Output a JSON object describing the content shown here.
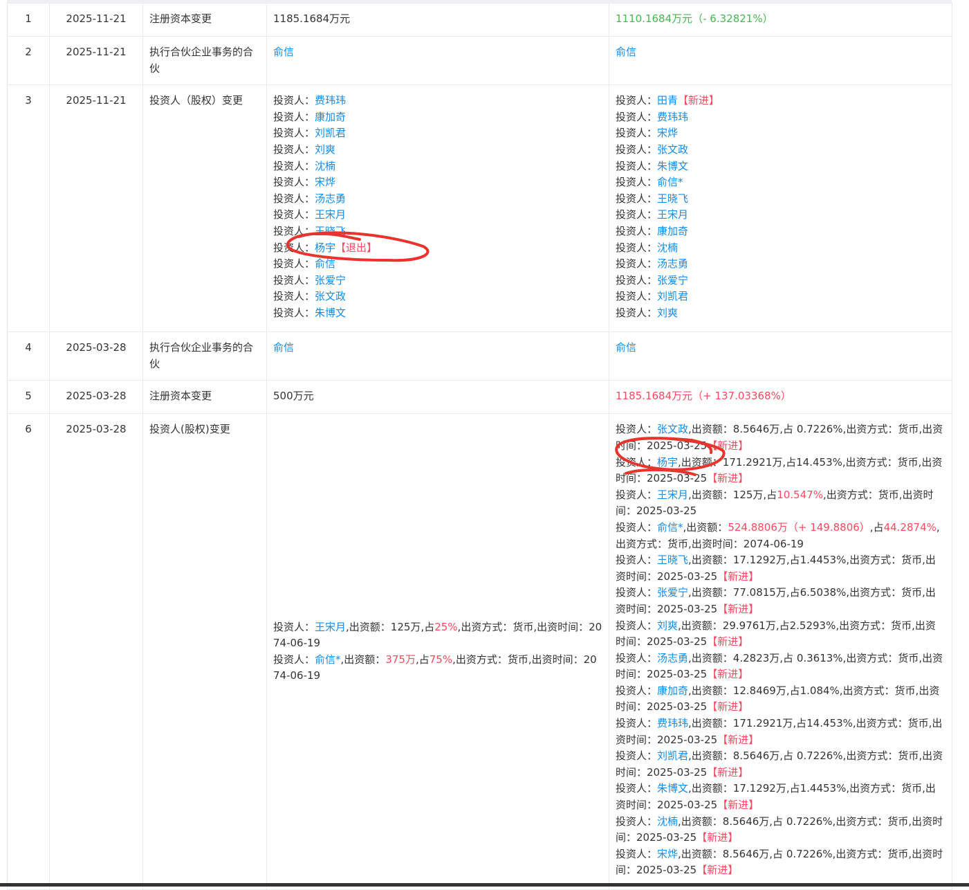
{
  "rows": [
    {
      "no": "1",
      "date": "2025-11-21",
      "item": "注册资本变更",
      "before_text": "1185.1684万元",
      "after_text": "1110.1684万元（- 6.32821%）"
    },
    {
      "no": "2",
      "date": "2025-11-21",
      "item": "执行合伙企业事务的合伙",
      "before_link": "俞信",
      "after_link": "俞信"
    },
    {
      "no": "3",
      "date": "2025-11-21",
      "item": "投资人（股权）变更",
      "before": [
        {
          "label": "投资人：",
          "name": "费玮玮"
        },
        {
          "label": "投资人：",
          "name": "康加奇"
        },
        {
          "label": "投资人：",
          "name": "刘凯君"
        },
        {
          "label": "投资人：",
          "name": "刘爽"
        },
        {
          "label": "投资人：",
          "name": "沈楠"
        },
        {
          "label": "投资人：",
          "name": "宋烨"
        },
        {
          "label": "投资人：",
          "name": "汤志勇"
        },
        {
          "label": "投资人：",
          "name": "王宋月"
        },
        {
          "label": "投资人：",
          "name": "王晓飞"
        },
        {
          "label": "投资人：",
          "name": "杨宇",
          "tag": "【退出】"
        },
        {
          "label": "投资人：",
          "name": "俞信"
        },
        {
          "label": "投资人：",
          "name": "张爱宁"
        },
        {
          "label": "投资人：",
          "name": "张文政"
        },
        {
          "label": "投资人：",
          "name": "朱博文"
        }
      ],
      "after": [
        {
          "label": "投资人：",
          "name": "田青",
          "tag": "【新进】"
        },
        {
          "label": "投资人：",
          "name": "费玮玮"
        },
        {
          "label": "投资人：",
          "name": "宋烨"
        },
        {
          "label": "投资人：",
          "name": "张文政"
        },
        {
          "label": "投资人：",
          "name": "朱博文"
        },
        {
          "label": "投资人：",
          "name": "俞信*"
        },
        {
          "label": "投资人：",
          "name": "王晓飞"
        },
        {
          "label": "投资人：",
          "name": "王宋月"
        },
        {
          "label": "投资人：",
          "name": "康加奇"
        },
        {
          "label": "投资人：",
          "name": "沈楠"
        },
        {
          "label": "投资人：",
          "name": "汤志勇"
        },
        {
          "label": "投资人：",
          "name": "张爱宁"
        },
        {
          "label": "投资人：",
          "name": "刘凯君"
        },
        {
          "label": "投资人：",
          "name": "刘爽"
        }
      ]
    },
    {
      "no": "4",
      "date": "2025-03-28",
      "item": "执行合伙企业事务的合伙",
      "before_link": "俞信",
      "after_link": "俞信"
    },
    {
      "no": "5",
      "date": "2025-03-28",
      "item": "注册资本变更",
      "before_text": "500万元",
      "after_text": "1185.1684万元（+ 137.03368%）"
    },
    {
      "no": "6",
      "date": "2025-03-28",
      "item": "投资人(股权)变更",
      "before": [
        {
          "label": "投资人：",
          "name": "王宋月",
          "t1": ",出资额：125万,占",
          "r1": "25%",
          "t2": ",出资方式：货币,出资时间：2074-06-19"
        },
        {
          "label": "投资人：",
          "name": "俞信*",
          "t1": ",出资额：",
          "r1": "375万",
          "t2": ",占",
          "r2": "75%",
          "t3": ",出资方式：货币,出资时间：2074-06-19"
        }
      ],
      "after": [
        {
          "label": "投资人：",
          "name": "张文政",
          "t1": ",出资额：8.5646万,占 0.7226%,出资方式：货币,出资时间：2025-03-25",
          "tag": "【新进】"
        },
        {
          "label": "投资人：",
          "name": "杨宇",
          "t1": ",出资额：171.2921万,占14.453%,出资方式：货币,出资时间：2025-03-25",
          "tag": "【新进】"
        },
        {
          "label": "投资人：",
          "name": "王宋月",
          "t1": ",出资额：125万,占",
          "r1": "10.547%",
          "t2": ",出资方式：货币,出资时间：2025-03-25"
        },
        {
          "label": "投资人：",
          "name": "俞信*",
          "t1": ",出资额：",
          "r1": "524.8806万（+ 149.8806）",
          "t2": ",占",
          "r2": "44.2874%",
          "t3": ",出资方式：货币,出资时间：2074-06-19"
        },
        {
          "label": "投资人：",
          "name": "王晓飞",
          "t1": ",出资额：17.1292万,占1.4453%,出资方式：货币,出资时间：2025-03-25",
          "tag": "【新进】"
        },
        {
          "label": "投资人：",
          "name": "张爱宁",
          "t1": ",出资额：77.0815万,占6.5038%,出资方式：货币,出资时间：2025-03-25",
          "tag": "【新进】"
        },
        {
          "label": "投资人：",
          "name": "刘爽",
          "t1": ",出资额：29.9761万,占2.5293%,出资方式：货币,出资时间：2025-03-25",
          "tag": "【新进】"
        },
        {
          "label": "投资人：",
          "name": "汤志勇",
          "t1": ",出资额：4.2823万,占 0.3613%,出资方式：货币,出资时间：2025-03-25",
          "tag": "【新进】"
        },
        {
          "label": "投资人：",
          "name": "康加奇",
          "t1": ",出资额：12.8469万,占1.084%,出资方式：货币,出资时间：2025-03-25",
          "tag": "【新进】"
        },
        {
          "label": "投资人：",
          "name": "费玮玮",
          "t1": ",出资额：171.2921万,占14.453%,出资方式：货币,出资时间：2025-03-25",
          "tag": "【新进】"
        },
        {
          "label": "投资人：",
          "name": "刘凯君",
          "t1": ",出资额：8.5646万,占 0.7226%,出资方式：货币,出资时间：2025-03-25",
          "tag": "【新进】"
        },
        {
          "label": "投资人：",
          "name": "朱博文",
          "t1": ",出资额：17.1292万,占1.4453%,出资方式：货币,出资时间：2025-03-25",
          "tag": "【新进】"
        },
        {
          "label": "投资人：",
          "name": "沈楠",
          "t1": ",出资额：8.5646万,占 0.7226%,出资方式：货币,出资时间：2025-03-25",
          "tag": "【新进】"
        },
        {
          "label": "投资人：",
          "name": "宋烨",
          "t1": ",出资额：8.5646万,占 0.7226%,出资方式：货币,出资时间：2025-03-25",
          "tag": "【新进】"
        }
      ]
    }
  ],
  "colors": {
    "link": "#128bed",
    "highlight_red": "#fd485e",
    "decrease_green": "#43b84f",
    "annotation_red": "#e8342c"
  }
}
